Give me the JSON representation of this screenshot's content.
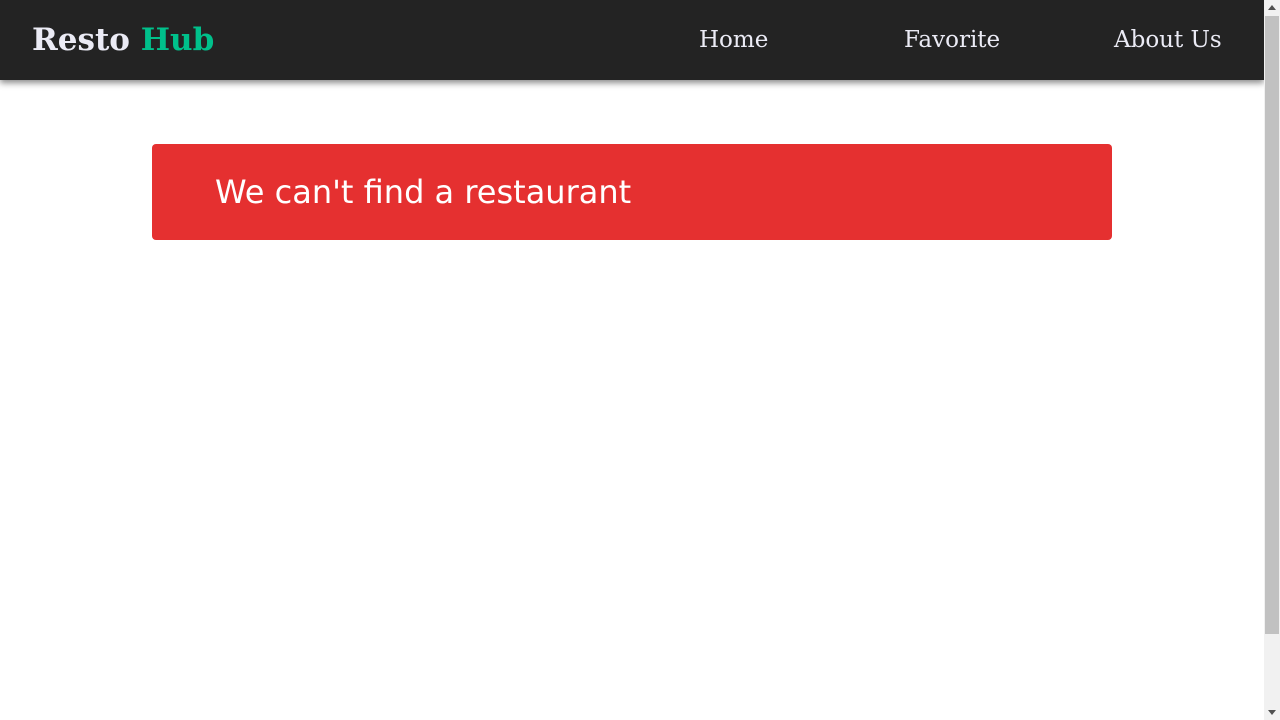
{
  "header": {
    "brand": {
      "primary": "Resto",
      "accent": "Hub"
    },
    "nav": {
      "home": "Home",
      "favorite": "Favorite",
      "about": "About Us"
    }
  },
  "main": {
    "alert_message": "We can't find a restaurant"
  },
  "colors": {
    "navbar_bg": "#232323",
    "brand_accent": "#00c08b",
    "nav_text": "#ebebf5",
    "alert_bg": "#e53030",
    "alert_text": "#ffffff"
  },
  "scrollbar": {
    "icons": [
      "scroll-up-arrow-icon",
      "scroll-down-arrow-icon"
    ]
  }
}
